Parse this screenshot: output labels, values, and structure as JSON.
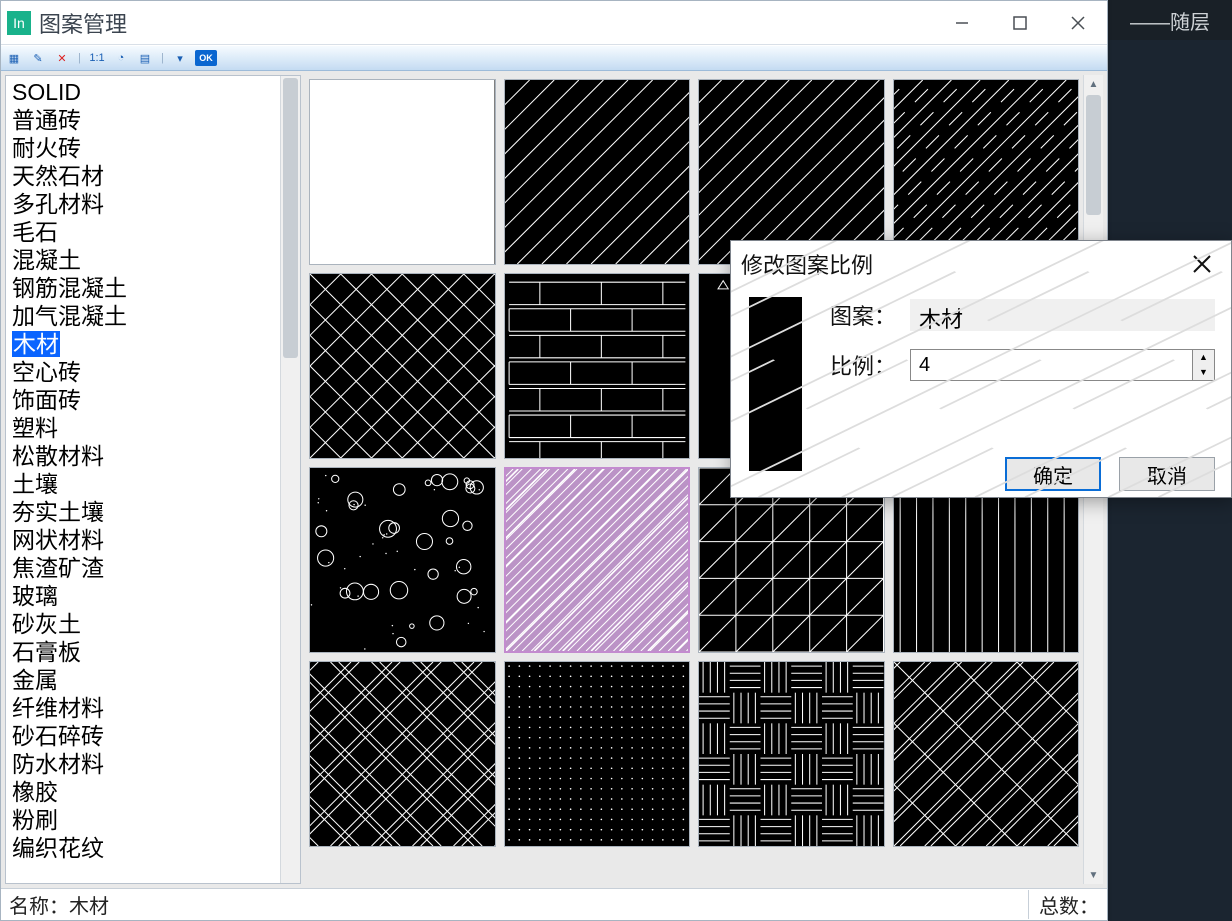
{
  "background_app": {
    "layer_label": "——随层"
  },
  "window": {
    "title": "图案管理",
    "controls": {
      "minimize": "−",
      "maximize": "□",
      "close": "×"
    }
  },
  "toolbar": {
    "items": [
      "new",
      "open",
      "delete",
      "|",
      "scale",
      "brush",
      "grid",
      "|",
      "dropdown",
      "ok"
    ],
    "ok_label": "OK"
  },
  "pattern_list": {
    "selected_index": 9,
    "items": [
      "SOLID",
      "普通砖",
      "耐火砖",
      "天然石材",
      "多孔材料",
      "毛石",
      "混凝土",
      "钢筋混凝土",
      "加气混凝土",
      "木材",
      "空心砖",
      "饰面砖",
      "塑料",
      "松散材料",
      "土壤",
      "夯实土壤",
      "网状材料",
      "焦渣矿渣",
      "玻璃",
      "砂灰土",
      "石膏板",
      "金属",
      "纤维材料",
      "砂石碎砖",
      "防水材料",
      "橡胶",
      "粉刷",
      "编织花纹"
    ]
  },
  "preview_grid": {
    "selected_index": 9,
    "swatches": [
      {
        "id": "solid",
        "name": "SOLID"
      },
      {
        "id": "diag45",
        "name": "普通砖"
      },
      {
        "id": "diag45b",
        "name": "耐火砖"
      },
      {
        "id": "dashdiag",
        "name": "天然石材"
      },
      {
        "id": "crosshatch",
        "name": "多孔材料"
      },
      {
        "id": "brick",
        "name": "毛石"
      },
      {
        "id": "tri",
        "name": "混凝土"
      },
      {
        "id": "rcconc",
        "name": "钢筋混凝土"
      },
      {
        "id": "bubbles",
        "name": "加气混凝土"
      },
      {
        "id": "wood",
        "name": "木材"
      },
      {
        "id": "gridtri",
        "name": "空心砖"
      },
      {
        "id": "vlines",
        "name": "饰面砖"
      },
      {
        "id": "diamond",
        "name": "塑料"
      },
      {
        "id": "dots",
        "name": "松散材料"
      },
      {
        "id": "weave",
        "name": "土壤"
      },
      {
        "id": "doublediag",
        "name": "夯实土壤"
      }
    ]
  },
  "status": {
    "name_label": "名称：",
    "name_value": "木材",
    "total_label": "总数："
  },
  "dialog": {
    "title": "修改图案比例",
    "pattern_label": "图案：",
    "pattern_value": "木材",
    "scale_label": "比例：",
    "scale_value": "4",
    "ok": "确定",
    "cancel": "取消"
  },
  "colors": {
    "select_blue": "#0a64ff",
    "wood_fill": "#bb93c6",
    "ok_blue": "#0a6dd6"
  }
}
